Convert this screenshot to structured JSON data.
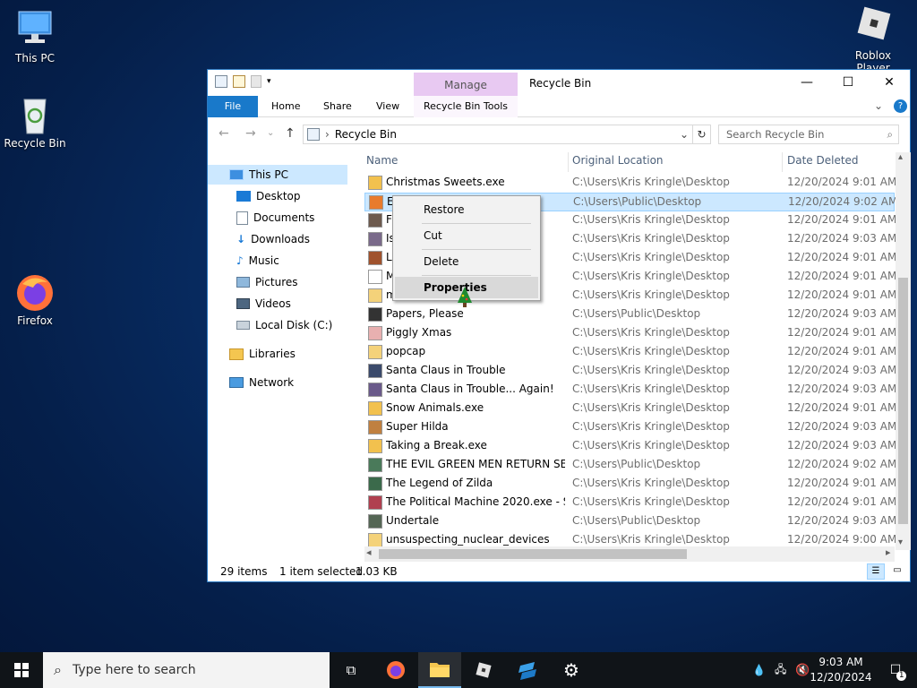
{
  "desktop": {
    "icons": [
      {
        "label": "This PC"
      },
      {
        "label": "Recycle Bin"
      },
      {
        "label": "Firefox"
      },
      {
        "label": "Roblox Player"
      }
    ]
  },
  "window": {
    "title": "Recycle Bin",
    "context_tab": "Manage",
    "ribbon_tabs": [
      "File",
      "Home",
      "Share",
      "View",
      "Recycle Bin Tools"
    ],
    "address": "Recycle Bin",
    "search_placeholder": "Search Recycle Bin",
    "nav_pane": [
      "This PC",
      "Desktop",
      "Documents",
      "Downloads",
      "Music",
      "Pictures",
      "Videos",
      "Local Disk (C:)",
      "Libraries",
      "Network"
    ],
    "columns": [
      "Name",
      "Original Location",
      "Date Deleted"
    ],
    "rows": [
      {
        "name": "Christmas Sweets.exe",
        "loc": "C:\\Users\\Kris Kringle\\Desktop",
        "date": "12/20/2024 9:01 AM"
      },
      {
        "name": "Everything",
        "loc": "C:\\Users\\Public\\Desktop",
        "date": "12/20/2024 9:02 AM"
      },
      {
        "name": "F",
        "loc": "C:\\Users\\Kris Kringle\\Desktop",
        "date": "12/20/2024 9:01 AM"
      },
      {
        "name": "Is",
        "loc": "C:\\Users\\Kris Kringle\\Desktop",
        "date": "12/20/2024 9:03 AM"
      },
      {
        "name": "L",
        "loc": "C:\\Users\\Kris Kringle\\Desktop",
        "date": "12/20/2024 9:01 AM"
      },
      {
        "name": "M...IT...",
        "loc": "C:\\Users\\Kris Kringle\\Desktop",
        "date": "12/20/2024 9:01 AM"
      },
      {
        "name": "m",
        "loc": "C:\\Users\\Kris Kringle\\Desktop",
        "date": "12/20/2024 9:01 AM"
      },
      {
        "name": "Papers, Please",
        "loc": "C:\\Users\\Public\\Desktop",
        "date": "12/20/2024 9:03 AM"
      },
      {
        "name": "Piggly Xmas",
        "loc": "C:\\Users\\Kris Kringle\\Desktop",
        "date": "12/20/2024 9:01 AM"
      },
      {
        "name": "popcap",
        "loc": "C:\\Users\\Kris Kringle\\Desktop",
        "date": "12/20/2024 9:01 AM"
      },
      {
        "name": "Santa Claus in Trouble",
        "loc": "C:\\Users\\Kris Kringle\\Desktop",
        "date": "12/20/2024 9:03 AM"
      },
      {
        "name": "Santa Claus in Trouble... Again!",
        "loc": "C:\\Users\\Kris Kringle\\Desktop",
        "date": "12/20/2024 9:03 AM"
      },
      {
        "name": "Snow Animals.exe",
        "loc": "C:\\Users\\Kris Kringle\\Desktop",
        "date": "12/20/2024 9:01 AM"
      },
      {
        "name": "Super Hilda",
        "loc": "C:\\Users\\Kris Kringle\\Desktop",
        "date": "12/20/2024 9:03 AM"
      },
      {
        "name": "Taking a Break.exe",
        "loc": "C:\\Users\\Kris Kringle\\Desktop",
        "date": "12/20/2024 9:03 AM"
      },
      {
        "name": "THE EVIL GREEN MEN RETURN SEV...",
        "loc": "C:\\Users\\Public\\Desktop",
        "date": "12/20/2024 9:02 AM"
      },
      {
        "name": "The Legend of Zilda",
        "loc": "C:\\Users\\Kris Kringle\\Desktop",
        "date": "12/20/2024 9:01 AM"
      },
      {
        "name": "The Political Machine 2020.exe - Sh...",
        "loc": "C:\\Users\\Kris Kringle\\Desktop",
        "date": "12/20/2024 9:01 AM"
      },
      {
        "name": "Undertale",
        "loc": "C:\\Users\\Public\\Desktop",
        "date": "12/20/2024 9:03 AM"
      },
      {
        "name": "unsuspecting_nuclear_devices",
        "loc": "C:\\Users\\Kris Kringle\\Desktop",
        "date": "12/20/2024 9:00 AM"
      }
    ],
    "status": {
      "count": "29 items",
      "selected": "1 item selected",
      "size": "1.03 KB"
    }
  },
  "context_menu": [
    "Restore",
    "Cut",
    "Delete",
    "Properties"
  ],
  "taskbar": {
    "search_placeholder": "Type here to search",
    "time": "9:03 AM",
    "date": "12/20/2024",
    "notification_count": "1"
  },
  "colors": {
    "accent": "#1979ca",
    "selection": "#cce8ff",
    "manage_tab": "#e8c9f2"
  }
}
